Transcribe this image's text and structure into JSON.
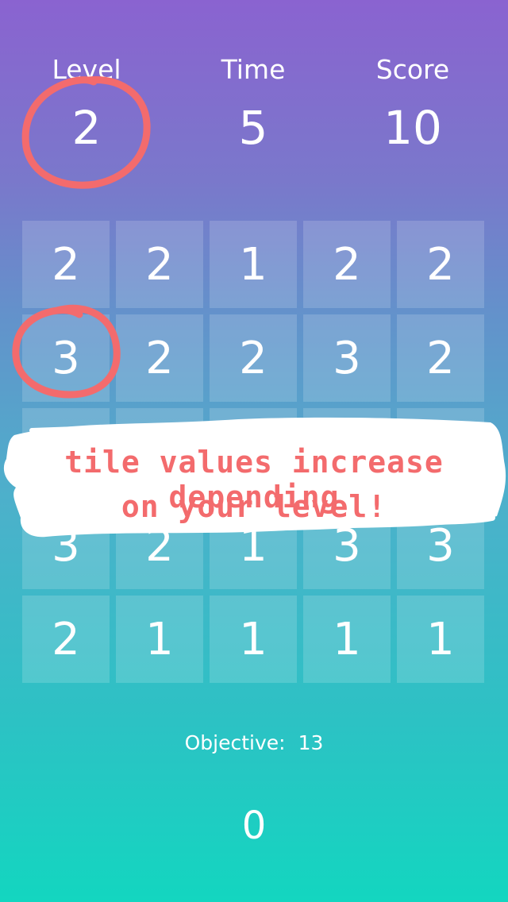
{
  "header": {
    "level": {
      "label": "Level",
      "value": "2"
    },
    "time": {
      "label": "Time",
      "value": "5"
    },
    "score": {
      "label": "Score",
      "value": "10"
    }
  },
  "board": {
    "rows": [
      [
        "2",
        "2",
        "1",
        "2",
        "2"
      ],
      [
        "3",
        "2",
        "2",
        "3",
        "2"
      ],
      [
        "",
        "",
        "",
        "",
        ""
      ],
      [
        "3",
        "2",
        "1",
        "3",
        "3"
      ],
      [
        "2",
        "1",
        "1",
        "1",
        "1"
      ]
    ]
  },
  "objective": {
    "label": "Objective:",
    "value": "13"
  },
  "current_sum": "0",
  "annotation": {
    "line1": "tile values increase depending",
    "line2": "on your  level!"
  },
  "colors": {
    "gradient_top": "#8a63d0",
    "gradient_bottom": "#13d6c0",
    "annotation_red": "#f36b6d",
    "tile_fill": "rgba(255,255,255,0.16)"
  }
}
